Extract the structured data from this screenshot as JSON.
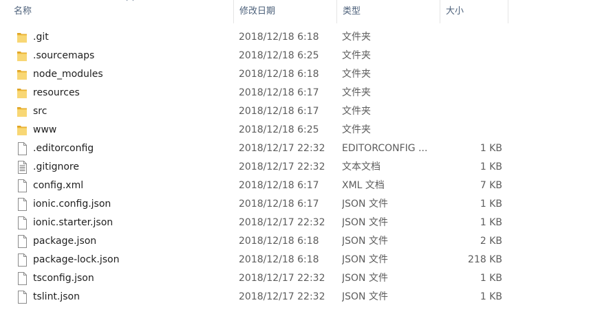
{
  "header": {
    "name_label": "名称",
    "date_label": "修改日期",
    "type_label": "类型",
    "size_label": "大小",
    "sort_indicator": "^"
  },
  "files": [
    {
      "name": ".git",
      "date": "2018/12/18 6:18",
      "type": "文件夹",
      "size": "",
      "icon": "folder-icon"
    },
    {
      "name": ".sourcemaps",
      "date": "2018/12/18 6:25",
      "type": "文件夹",
      "size": "",
      "icon": "folder-icon"
    },
    {
      "name": "node_modules",
      "date": "2018/12/18 6:18",
      "type": "文件夹",
      "size": "",
      "icon": "folder-icon"
    },
    {
      "name": "resources",
      "date": "2018/12/18 6:17",
      "type": "文件夹",
      "size": "",
      "icon": "folder-icon"
    },
    {
      "name": "src",
      "date": "2018/12/18 6:17",
      "type": "文件夹",
      "size": "",
      "icon": "folder-icon"
    },
    {
      "name": "www",
      "date": "2018/12/18 6:25",
      "type": "文件夹",
      "size": "",
      "icon": "folder-icon"
    },
    {
      "name": ".editorconfig",
      "date": "2018/12/17 22:32",
      "type": "EDITORCONFIG ...",
      "size": "1 KB",
      "icon": "file-icon"
    },
    {
      "name": ".gitignore",
      "date": "2018/12/17 22:32",
      "type": "文本文档",
      "size": "1 KB",
      "icon": "text-document-icon"
    },
    {
      "name": "config.xml",
      "date": "2018/12/18 6:17",
      "type": "XML 文档",
      "size": "7 KB",
      "icon": "file-icon"
    },
    {
      "name": "ionic.config.json",
      "date": "2018/12/18 6:17",
      "type": "JSON 文件",
      "size": "1 KB",
      "icon": "file-icon"
    },
    {
      "name": "ionic.starter.json",
      "date": "2018/12/17 22:32",
      "type": "JSON 文件",
      "size": "1 KB",
      "icon": "file-icon"
    },
    {
      "name": "package.json",
      "date": "2018/12/18 6:18",
      "type": "JSON 文件",
      "size": "2 KB",
      "icon": "file-icon"
    },
    {
      "name": "package-lock.json",
      "date": "2018/12/18 6:18",
      "type": "JSON 文件",
      "size": "218 KB",
      "icon": "file-icon"
    },
    {
      "name": "tsconfig.json",
      "date": "2018/12/17 22:32",
      "type": "JSON 文件",
      "size": "1 KB",
      "icon": "file-icon"
    },
    {
      "name": "tslint.json",
      "date": "2018/12/17 22:32",
      "type": "JSON 文件",
      "size": "1 KB",
      "icon": "file-icon"
    }
  ],
  "colors": {
    "header_text": "#4c607a",
    "folder_yellow": "#f8d775",
    "folder_dark": "#e0a526",
    "text_secondary": "#5c5c5c"
  }
}
